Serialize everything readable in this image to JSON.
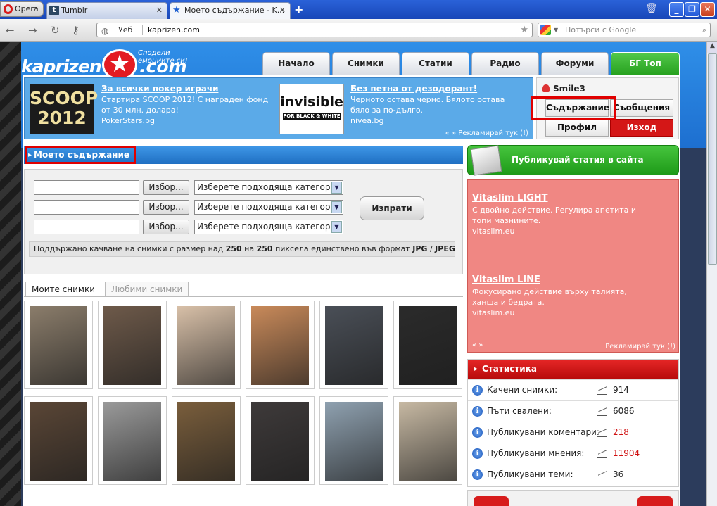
{
  "browser": {
    "opera_label": "Opera",
    "tabs": [
      {
        "label": "Tumblr"
      },
      {
        "label": "Моето съдържание - K..."
      }
    ],
    "new_tab_glyph": "+",
    "address_scheme_label": "Уеб",
    "address_url": "kaprizen.com",
    "search_placeholder": "Потърси с Google"
  },
  "site": {
    "logo_left": "kaprizen",
    "logo_right": ".com",
    "slogan": "Сподели емоциите си!",
    "nav": [
      "Начало",
      "Снимки",
      "Статии",
      "Радио",
      "Форуми",
      "БГ Топ"
    ]
  },
  "ads": {
    "a1": {
      "image_text": "SCOOP 2012",
      "title": "За всички покер играчи",
      "body": "Стартира SCOOP 2012! С награден фонд от 30 млн. долара!",
      "domain": "PokerStars.bg"
    },
    "a2": {
      "image_text": "invisible",
      "image_sub": "FOR BLACK & WHITE",
      "title": "Без петна от дезодорант!",
      "body": "Черното остава черно. Бялото остава бяло за по-дълго.",
      "domain": "nivea.bg"
    },
    "more": "« » Рекламирай тук (!)"
  },
  "user": {
    "name": "Smile3",
    "content_btn": "Съдържание",
    "messages_btn": "Съобщения",
    "profile_btn": "Профил",
    "logout_btn": "Изход"
  },
  "my_content": {
    "heading": "Моето съдържание",
    "browse_label": "Избор...",
    "category_placeholder": "Изберете подходяща категория",
    "send_label": "Изпрати",
    "notice_prefix": "Поддържано качване на снимки с размер над ",
    "notice_w": "250",
    "notice_mid": " на ",
    "notice_h": "250",
    "notice_mid2": " пиксела единствено във формат ",
    "notice_fmt1": "JPG",
    "notice_sep": " / ",
    "notice_fmt2": "JPEG",
    "notice_end": "!",
    "tab_mine": "Моите снимки",
    "tab_fav": "Любими снимки"
  },
  "photo_colors": [
    [
      "#8b7d6b",
      "#6e5a4a",
      "#d8c0a8",
      "#c98a5a",
      "#4a4f57",
      "#2b2b2b"
    ],
    [
      "#5a4636",
      "#9a9a9a",
      "#7a5e3c",
      "#3e3a3a",
      "#8fa1b0",
      "#c7b9a3"
    ]
  ],
  "publish": {
    "label": "Публикувай статия в сайта"
  },
  "side_ad": {
    "t1": "Vitaslim LIGHT",
    "b1": "С двойно действие. Регулира апетита и топи мазнините.",
    "d1": "vitaslim.eu",
    "t2": "Vitaslim LINE",
    "b2": "Фокусирано действие върху талията, ханша и бедрата.",
    "d2": "vitaslim.eu",
    "arrows": "« »",
    "more": "Рекламирай тук (!)"
  },
  "stats": {
    "heading": "Статистика",
    "rows": [
      {
        "label": "Качени снимки:",
        "value": "914"
      },
      {
        "label": "Пъти свалени:",
        "value": "6086"
      },
      {
        "label": "Публикувани коментари:",
        "value": "218"
      },
      {
        "label": "Публикувани мнения:",
        "value": "11904"
      },
      {
        "label": "Публикувани теми:",
        "value": "36"
      }
    ]
  },
  "colors": {
    "accent_blue": "#1f6fc2",
    "accent_green": "#26a01e",
    "accent_red": "#d41717",
    "highlight": "#e00000"
  }
}
